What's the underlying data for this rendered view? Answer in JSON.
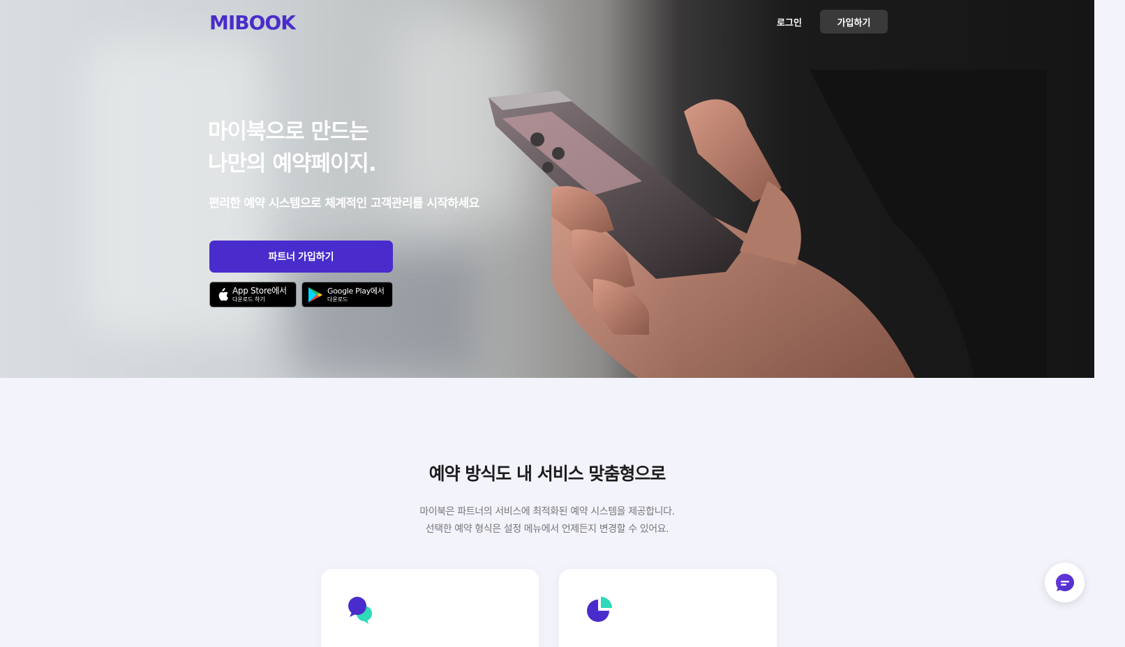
{
  "header": {
    "logo_text": "MIBOOK",
    "login_label": "로그인",
    "signup_label": "가입하기"
  },
  "hero": {
    "title_line1": "마이북으로 만드는",
    "title_line2": "나만의 예약페이지.",
    "subtitle": "편리한 예약 시스템으로 체계적인 고객관리를 시작하세요",
    "partner_button": "파트너 가입하기",
    "app_store": {
      "main": "App Store에서",
      "small": "다운로드 하기"
    },
    "google_play": {
      "main": "Google Play에서",
      "small": "다운로드"
    }
  },
  "section": {
    "title": "예약 방식도 내 서비스 맞춤형으로",
    "desc_line1": "마이북은 파트너의 서비스에 최적화된 예약 시스템을 제공합니다.",
    "desc_line2": "선택한 예약 형식은 설정 메뉴에서 언제든지 변경할 수 있어요.",
    "cards": [
      {
        "icon": "chat-bubbles-icon"
      },
      {
        "icon": "pie-chart-icon"
      }
    ]
  },
  "chat_widget": {
    "icon": "chat-icon"
  },
  "colors": {
    "brand": "#4a2ccc",
    "accent": "#2fd9b9",
    "background": "#f3f3fb"
  }
}
